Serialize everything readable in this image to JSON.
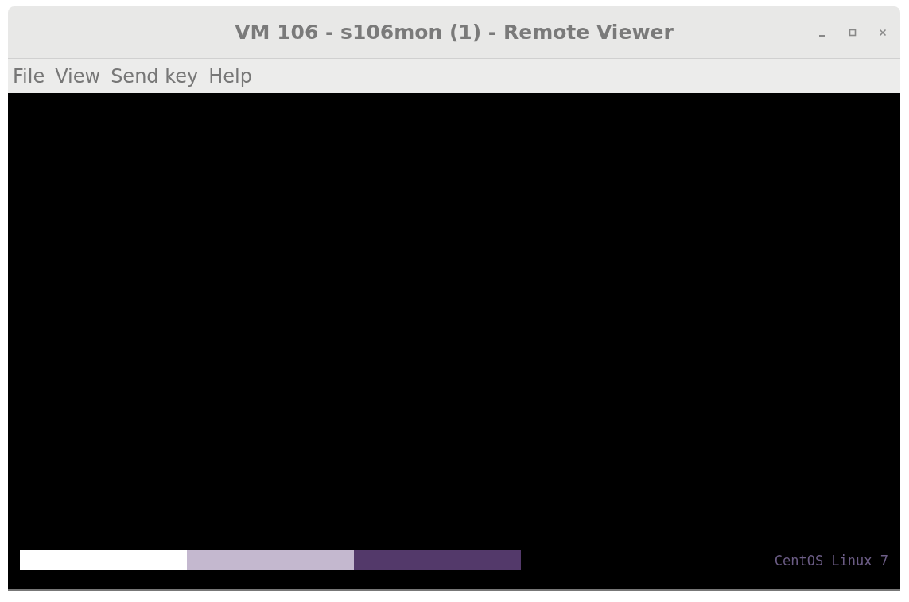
{
  "window": {
    "title": "VM 106 - s106mon (1) - Remote Viewer"
  },
  "menu": [
    "File",
    "View",
    "Send key",
    "Help"
  ],
  "boot_screen": {
    "progress_segments": [
      {
        "color": "#ffffff"
      },
      {
        "color": "#c4b8cf"
      },
      {
        "color": "#53396a"
      }
    ],
    "os_label": "CentOS Linux 7"
  }
}
